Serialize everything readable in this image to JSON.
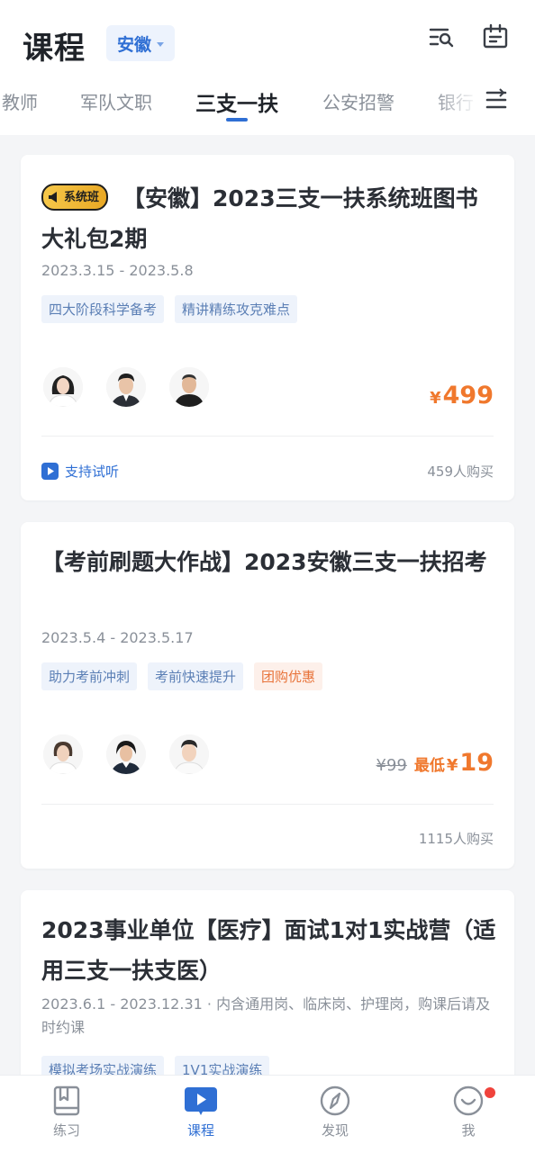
{
  "header": {
    "title": "课程",
    "region": "安徽",
    "icons": [
      "search-list-icon",
      "calendar-icon"
    ]
  },
  "tabs": [
    {
      "label": "教师",
      "active": false
    },
    {
      "label": "军队文职",
      "active": false
    },
    {
      "label": "三支一扶",
      "active": true
    },
    {
      "label": "公安招警",
      "active": false
    },
    {
      "label": "银行",
      "active": false
    }
  ],
  "courses": [
    {
      "badge": "系统班",
      "title": "【安徽】2023三支一扶系统班图书大礼包2期",
      "date": "2023.3.15 - 2023.5.8",
      "tags": [
        "四大阶段科学备考",
        "精讲精练攻克难点"
      ],
      "price_symbol": "¥",
      "price": "499",
      "trial": "支持试听",
      "buyers": "459人购买"
    },
    {
      "title": "【考前刷题大作战】2023安徽三支一扶招考",
      "date": "2023.5.4 - 2023.5.17",
      "tags": [
        "助力考前冲刺",
        "考前快速提升",
        "团购优惠"
      ],
      "original_price": "¥99",
      "price_prefix": "最低",
      "price_symbol": "¥",
      "price": "19",
      "buyers": "1115人购买"
    },
    {
      "title": "2023事业单位【医疗】面试1对1实战营（适用三支一扶支医）",
      "date": "2023.6.1 - 2023.12.31 · 内含通用岗、临床岗、护理岗，购课后请及时约课",
      "tags": [
        "模拟考场实战演练",
        "1V1实战演练"
      ]
    }
  ],
  "bottom_nav": [
    {
      "label": "练习",
      "icon": "book-icon",
      "active": false
    },
    {
      "label": "课程",
      "icon": "play-icon",
      "active": true
    },
    {
      "label": "发现",
      "icon": "compass-icon",
      "active": false
    },
    {
      "label": "我",
      "icon": "smile-icon",
      "active": false
    }
  ],
  "colors": {
    "accent": "#2f6fd4",
    "price": "#f0782d",
    "notification": "#f0433c"
  }
}
